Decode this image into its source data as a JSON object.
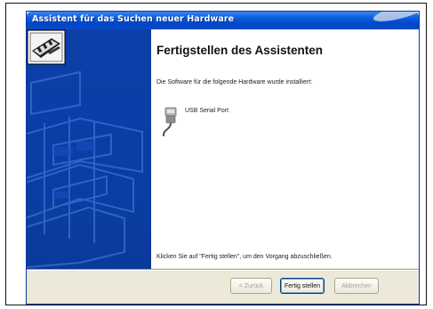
{
  "window": {
    "title": "Assistent für das Suchen neuer Hardware"
  },
  "wizard": {
    "heading": "Fertigstellen des Assistenten",
    "intro": "Die Software für die folgende Hardware wurde installiert:",
    "device": {
      "name": "USB Serial Port",
      "icon": "usb-plug-icon"
    },
    "instruction": "Klicken Sie auf \"Fertig stellen\", um den Vorgang abzuschließen."
  },
  "buttons": {
    "back": "< Zurück",
    "finish": "Fertig stellen",
    "cancel": "Abbrechen"
  },
  "colors": {
    "titlebar": "#0046c8",
    "sidebar": "#0a3ea5",
    "dialog_bg": "#ece9d8"
  }
}
